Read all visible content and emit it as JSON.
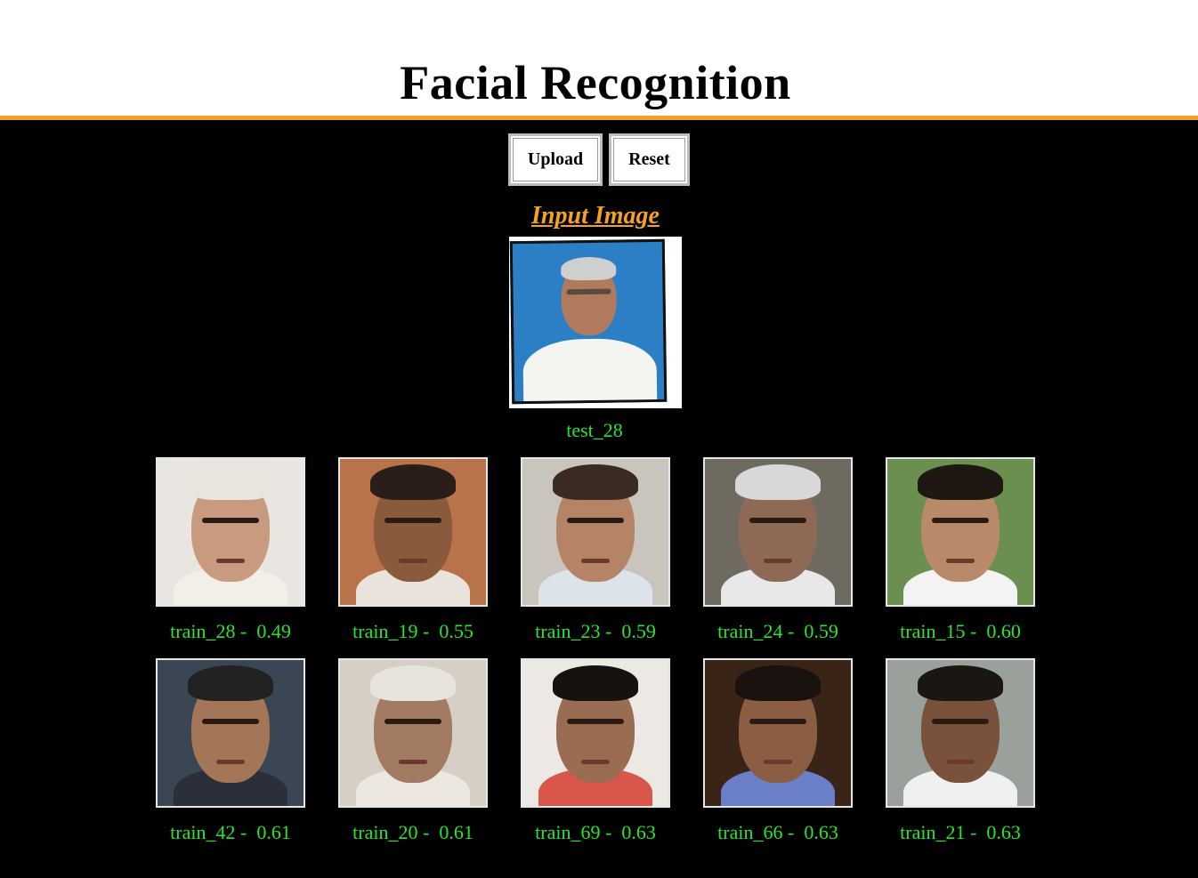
{
  "header": {
    "title": "Facial Recognition"
  },
  "toolbar": {
    "upload_label": "Upload",
    "reset_label": "Reset"
  },
  "input": {
    "heading": "Input Image",
    "caption": "test_28"
  },
  "colors": {
    "accent": "#f5a21e",
    "caption_green": "#27e62c",
    "background": "#000000"
  },
  "results": [
    {
      "label": "train_28 -  0.49"
    },
    {
      "label": "train_19 -  0.55"
    },
    {
      "label": "train_23 -  0.59"
    },
    {
      "label": "train_24 -  0.59"
    },
    {
      "label": "train_15 -  0.60"
    },
    {
      "label": "train_42 -  0.61"
    },
    {
      "label": "train_20 -  0.61"
    },
    {
      "label": "train_69 -  0.63"
    },
    {
      "label": "train_66 -  0.63"
    },
    {
      "label": "train_21 -  0.63"
    }
  ]
}
